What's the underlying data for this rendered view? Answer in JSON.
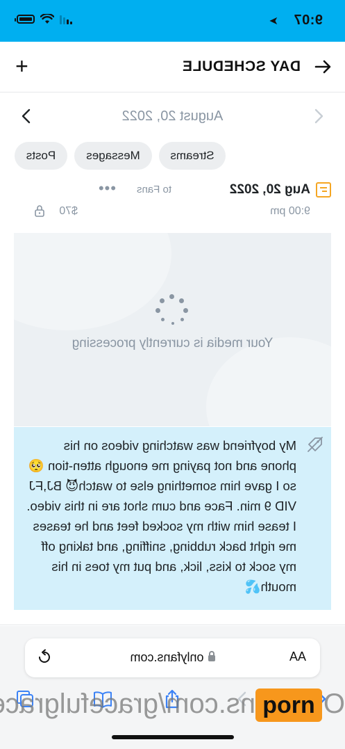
{
  "status_bar": {
    "time": "9:07",
    "background_color": "#00aff0"
  },
  "header": {
    "title": "DAY SCHEDULE",
    "back_icon": "arrow-left-icon",
    "add_icon": "plus-icon"
  },
  "date_nav": {
    "date": "August 20, 2022"
  },
  "tabs": [
    {
      "label": "Posts"
    },
    {
      "label": "Messages"
    },
    {
      "label": "Streams"
    }
  ],
  "post": {
    "date": "Aug 20, 2022",
    "time": "9:00 pm",
    "audience": "to Fans",
    "more": "•••",
    "price": "$70",
    "media_message": "Your media is currently processing",
    "caption": "My boyfriend was watching videos on his phone and not paying me enough atten-tion 🥺 so I gave him something else to watch😈 BJ,FJ VID 9 min. Face and cum shot are in this video. I tease him with my socked feet and he teases me right back rubbing, sniffing, and taking off my sock to kiss, lick, and put my toes in his mouth💦",
    "accent_color": "#f5a623",
    "caption_bg": "#d4f0fb"
  },
  "browser": {
    "text_size_label": "AA",
    "url": "onlyfans.com"
  },
  "watermark": {
    "url_text": "OnlyFans.com/gracefulgrace",
    "badge_text": "porn",
    "badge_color": "#f7971c"
  }
}
